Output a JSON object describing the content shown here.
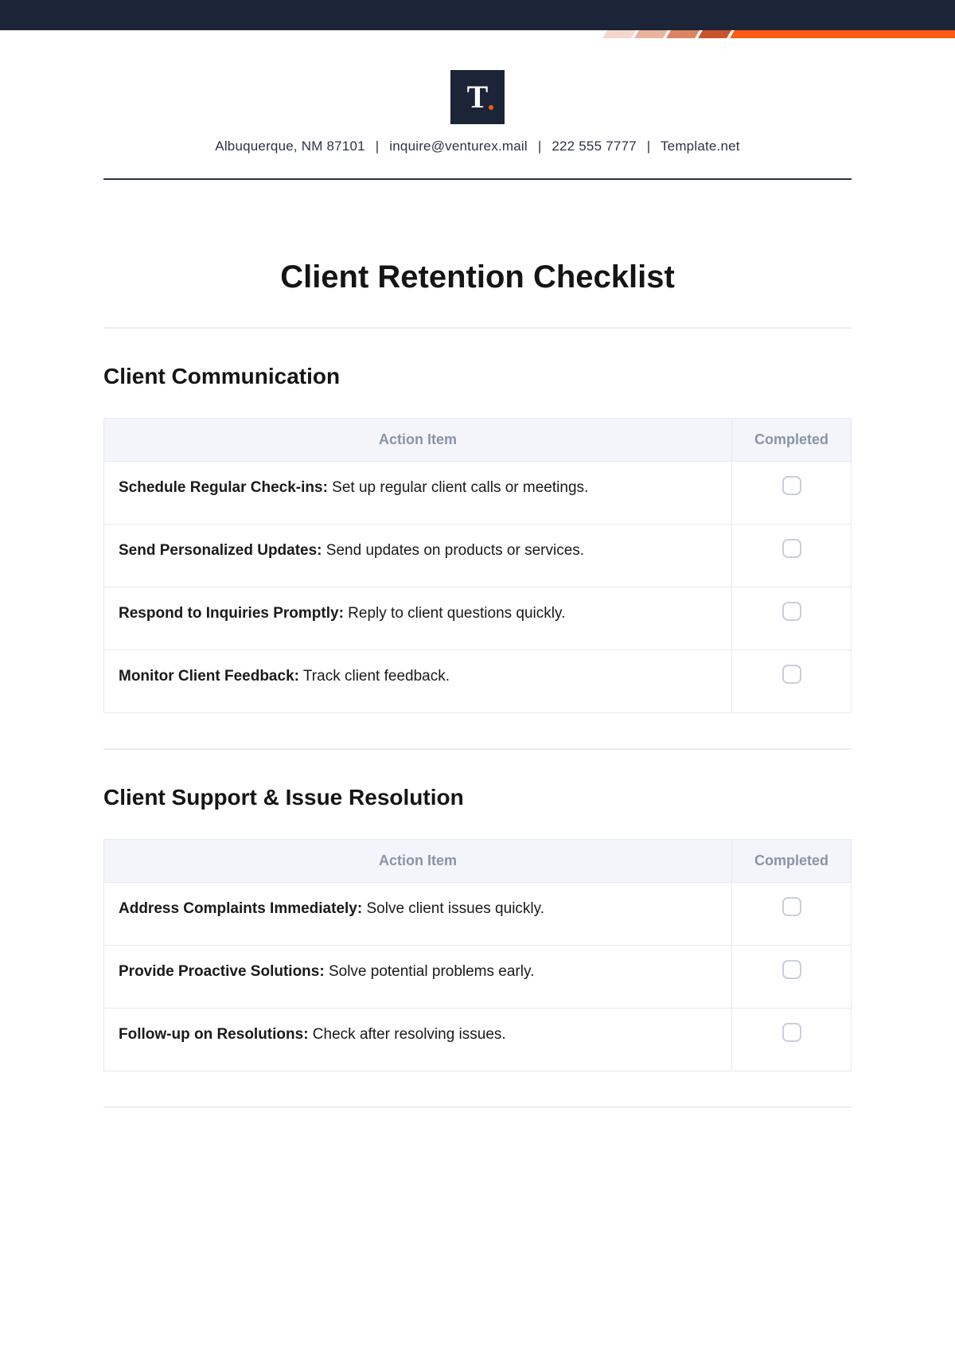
{
  "header": {
    "logo_letter": "T",
    "address": "Albuquerque, NM 87101",
    "email": "inquire@venturex.mail",
    "phone": "222 555 7777",
    "site": "Template.net"
  },
  "title": "Client Retention Checklist",
  "table_headers": {
    "action": "Action Item",
    "completed": "Completed"
  },
  "sections": [
    {
      "heading": "Client Communication",
      "items": [
        {
          "title": "Schedule Regular Check-ins:",
          "desc": " Set up regular client calls or meetings."
        },
        {
          "title": "Send Personalized Updates:",
          "desc": " Send updates on products or services."
        },
        {
          "title": "Respond to Inquiries Promptly:",
          "desc": " Reply to client questions quickly."
        },
        {
          "title": "Monitor Client Feedback:",
          "desc": " Track client feedback."
        }
      ]
    },
    {
      "heading": "Client Support & Issue Resolution",
      "items": [
        {
          "title": "Address Complaints Immediately:",
          "desc": " Solve client issues quickly."
        },
        {
          "title": "Provide Proactive Solutions:",
          "desc": " Solve potential problems early."
        },
        {
          "title": "Follow-up on Resolutions:",
          "desc": " Check after resolving issues."
        }
      ]
    }
  ]
}
